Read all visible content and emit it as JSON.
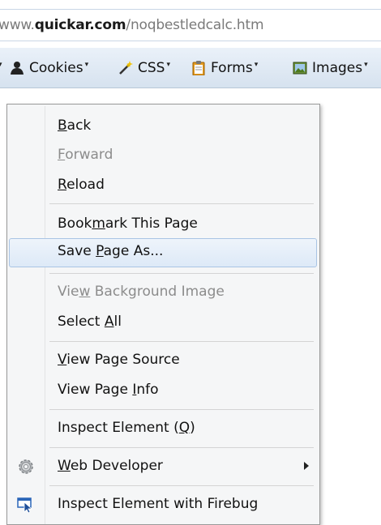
{
  "address_bar": {
    "url_prefix": "www.",
    "url_domain": "quickar.com",
    "url_path": "/noqbestledcalc.htm"
  },
  "toolbar": {
    "items": [
      {
        "label": "Cookies",
        "icon": "cookie-person-icon"
      },
      {
        "label": "CSS",
        "icon": "css-wand-icon"
      },
      {
        "label": "Forms",
        "icon": "clipboard-icon"
      },
      {
        "label": "Images",
        "icon": "image-icon"
      }
    ]
  },
  "context_menu": {
    "back": {
      "before": "",
      "access": "B",
      "after": "ack"
    },
    "forward": {
      "before": "",
      "access": "F",
      "after": "orward"
    },
    "reload": {
      "before": "",
      "access": "R",
      "after": "eload"
    },
    "bookmark": {
      "before": "Book",
      "access": "m",
      "after": "ark This Page"
    },
    "save_page": {
      "before": "Save ",
      "access": "P",
      "after": "age As..."
    },
    "view_bg_image": {
      "before": "Vie",
      "access": "w",
      "after": " Background Image"
    },
    "select_all": {
      "before": "Select ",
      "access": "A",
      "after": "ll"
    },
    "view_source": {
      "before": "",
      "access": "V",
      "after": "iew Page Source"
    },
    "view_info": {
      "before": "View Page ",
      "access": "I",
      "after": "nfo"
    },
    "inspect": {
      "before": "Inspect Element (",
      "access": "Q",
      "after": ")"
    },
    "web_developer": {
      "before": "",
      "access": "W",
      "after": "eb Developer"
    },
    "firebug": {
      "label": "Inspect Element with Firebug"
    }
  }
}
